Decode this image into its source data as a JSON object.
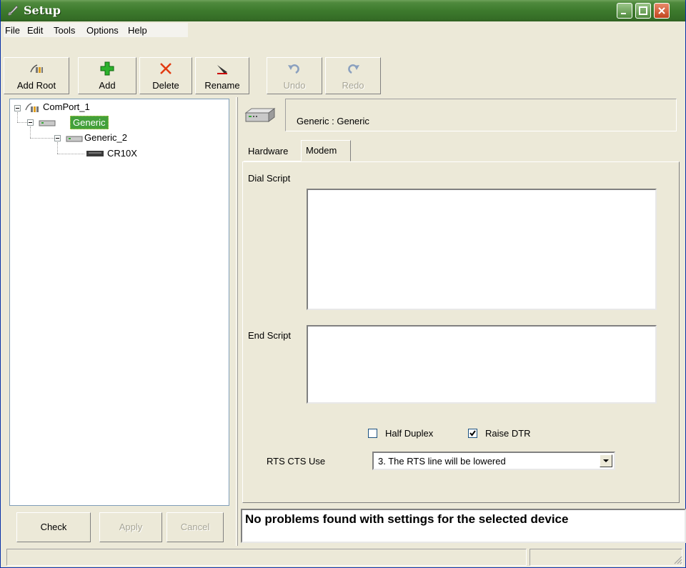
{
  "window": {
    "title": "Setup"
  },
  "menu": [
    "File",
    "Edit",
    "Tools",
    "Options",
    "Help"
  ],
  "toolbar": {
    "add_root": "Add Root",
    "add": "Add",
    "delete": "Delete",
    "rename": "Rename",
    "undo": "Undo",
    "redo": "Redo"
  },
  "tree": {
    "root": "ComPort_1",
    "generic": "Generic",
    "generic_2": "Generic_2",
    "cr10x": "CR10X"
  },
  "bottom_buttons": {
    "check": "Check",
    "apply": "Apply",
    "cancel": "Cancel"
  },
  "device": {
    "title": "Generic : Generic"
  },
  "tabs": {
    "hardware": "Hardware",
    "modem": "Modem"
  },
  "modem": {
    "dial_script_label": "Dial Script",
    "dial_script_value": "",
    "end_script_label": "End Script",
    "end_script_value": "",
    "half_duplex_label": "Half Duplex",
    "half_duplex_checked": false,
    "raise_dtr_label": "Raise DTR",
    "raise_dtr_checked": true,
    "rts_label": "RTS CTS Use",
    "rts_value": "3. The RTS line will be lowered"
  },
  "status": {
    "message": "No problems found with settings for the selected device"
  },
  "colors": {
    "title_bar": "#3d7a2d",
    "selection": "#43a03a"
  }
}
